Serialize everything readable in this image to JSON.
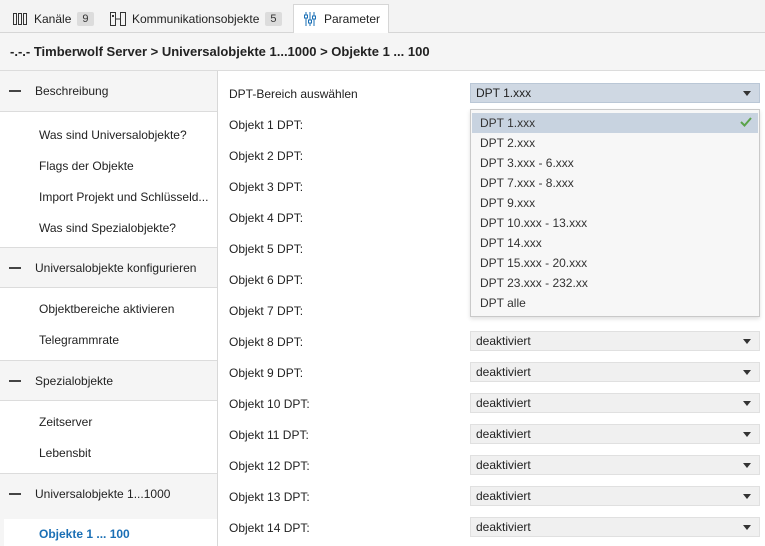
{
  "tabs": [
    {
      "label": "Kanäle",
      "badge": "9",
      "icon": "columns-icon"
    },
    {
      "label": "Kommunikationsobjekte",
      "badge": "5",
      "icon": "objects-icon"
    },
    {
      "label": "Parameter",
      "icon": "sliders-icon"
    }
  ],
  "breadcrumb": "-.-.- Timberwolf Server > Universalobjekte 1...1000 > Objekte 1 ... 100",
  "sidebar": {
    "groups": [
      {
        "label": "Beschreibung",
        "items": [
          "Was sind Universalobjekte?",
          "Flags der Objekte",
          "Import Projekt und Schlüsseld...",
          "Was sind Spezialobjekte?"
        ]
      },
      {
        "label": "Universalobjekte konfigurieren",
        "items": [
          "Objektbereiche aktivieren",
          "Telegrammrate"
        ]
      },
      {
        "label": "Spezialobjekte",
        "items": [
          "Zeitserver",
          "Lebensbit"
        ]
      },
      {
        "label": "Universalobjekte 1...1000",
        "items": []
      }
    ],
    "selected": "Objekte 1 ... 100"
  },
  "main": {
    "range_label": "DPT-Bereich auswählen",
    "range_value": "DPT 1.xxx",
    "dropdown_options": [
      "DPT 1.xxx",
      "DPT 2.xxx",
      "DPT 3.xxx - 6.xxx",
      "DPT 7.xxx - 8.xxx",
      "DPT 9.xxx",
      "DPT 10.xxx - 13.xxx",
      "DPT 14.xxx",
      "DPT 15.xxx - 20.xxx",
      "DPT 23.xxx - 232.xx",
      "DPT alle"
    ],
    "objects": [
      {
        "label": "Objekt 1 DPT:",
        "value": ""
      },
      {
        "label": "Objekt 2 DPT:",
        "value": ""
      },
      {
        "label": "Objekt 3 DPT:",
        "value": ""
      },
      {
        "label": "Objekt 4 DPT:",
        "value": ""
      },
      {
        "label": "Objekt 5 DPT:",
        "value": ""
      },
      {
        "label": "Objekt 6 DPT:",
        "value": ""
      },
      {
        "label": "Objekt 7 DPT:",
        "value": ""
      },
      {
        "label": "Objekt 8 DPT:",
        "value": "deaktiviert"
      },
      {
        "label": "Objekt 9 DPT:",
        "value": "deaktiviert"
      },
      {
        "label": "Objekt 10 DPT:",
        "value": "deaktiviert"
      },
      {
        "label": "Objekt 11 DPT:",
        "value": "deaktiviert"
      },
      {
        "label": "Objekt 12 DPT:",
        "value": "deaktiviert"
      },
      {
        "label": "Objekt 13 DPT:",
        "value": "deaktiviert"
      },
      {
        "label": "Objekt 14 DPT:",
        "value": "deaktiviert"
      }
    ]
  },
  "colors": {
    "accent": "#1a6fb5",
    "check": "#5aa34a",
    "selected_option": "#c8d3e0"
  }
}
